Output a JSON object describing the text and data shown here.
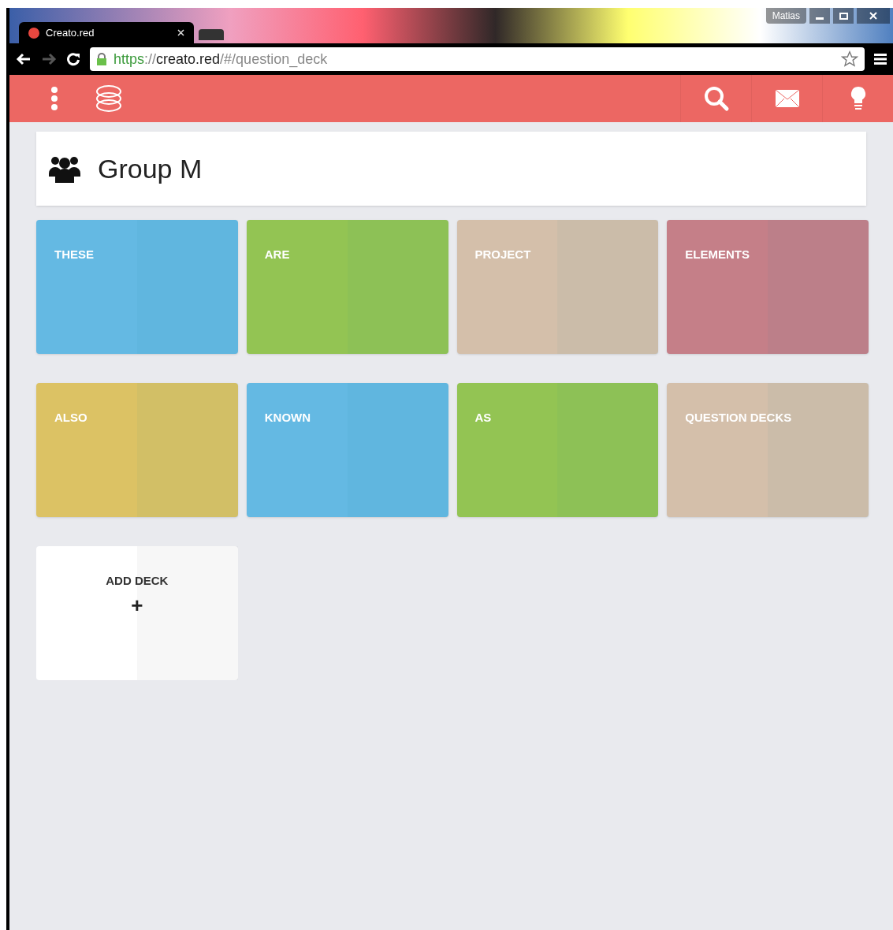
{
  "browser": {
    "profile": "Matias",
    "tab": {
      "title": "Creato.red"
    },
    "url": {
      "scheme": "https",
      "separator": "://",
      "host": "creato.red",
      "path": "/#/question_deck"
    }
  },
  "group": {
    "title": "Group M"
  },
  "decks": [
    {
      "kind": "deck",
      "label": "THESE",
      "color": "#64b9e3"
    },
    {
      "kind": "deck",
      "label": "ARE",
      "color": "#93c453"
    },
    {
      "kind": "deck",
      "label": "PROJECT",
      "color": "#d4bfaa"
    },
    {
      "kind": "deck",
      "label": "ELEMENTS",
      "color": "#c57f88"
    },
    {
      "kind": "deck",
      "label": "ALSO",
      "color": "#dcc264"
    },
    {
      "kind": "deck",
      "label": "KNOWN",
      "color": "#64b9e3"
    },
    {
      "kind": "deck",
      "label": "AS",
      "color": "#93c453"
    },
    {
      "kind": "deck",
      "label": "QUESTION DECKS",
      "color": "#d4bfaa"
    },
    {
      "kind": "add",
      "label": "ADD DECK",
      "icon": "+"
    }
  ]
}
